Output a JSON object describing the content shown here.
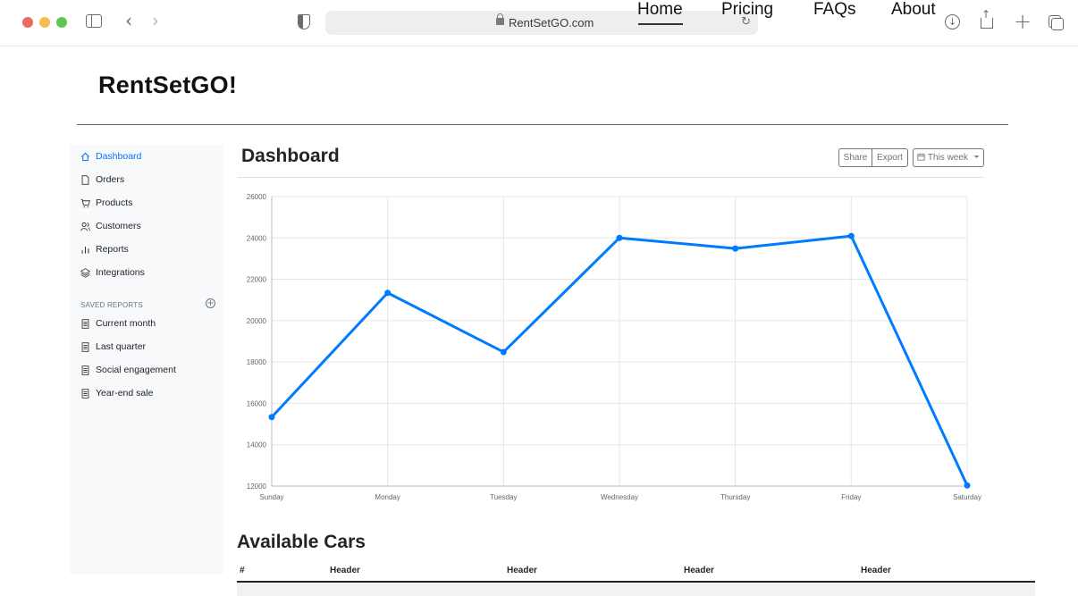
{
  "browser": {
    "url": "RentSetGO.com"
  },
  "site": {
    "brand": "RentSetGO!",
    "nav": [
      "Home",
      "Pricing",
      "FAQs",
      "About"
    ]
  },
  "sidebar": {
    "items": [
      {
        "label": "Dashboard",
        "icon": "home-icon"
      },
      {
        "label": "Orders",
        "icon": "file-icon"
      },
      {
        "label": "Products",
        "icon": "cart-icon"
      },
      {
        "label": "Customers",
        "icon": "users-icon"
      },
      {
        "label": "Reports",
        "icon": "bar-chart-icon"
      },
      {
        "label": "Integrations",
        "icon": "layers-icon"
      }
    ],
    "saved_heading": "SAVED REPORTS",
    "saved": [
      {
        "label": "Current month",
        "icon": "file-text-icon"
      },
      {
        "label": "Last quarter",
        "icon": "file-text-icon"
      },
      {
        "label": "Social engagement",
        "icon": "file-text-icon"
      },
      {
        "label": "Year-end sale",
        "icon": "file-text-icon"
      }
    ]
  },
  "main": {
    "title": "Dashboard",
    "toolbar": {
      "share": "Share",
      "export": "Export",
      "range": "This week"
    },
    "section_title": "Available Cars",
    "table_headers": [
      "#",
      "Header",
      "Header",
      "Header",
      "Header"
    ]
  },
  "colors": {
    "accent": "#007bff",
    "active_link": "#0d6efd"
  },
  "chart_data": {
    "type": "line",
    "categories": [
      "Sunday",
      "Monday",
      "Tuesday",
      "Wednesday",
      "Thursday",
      "Friday",
      "Saturday"
    ],
    "values": [
      15339,
      21345,
      18483,
      24003,
      23489,
      24092,
      12034
    ],
    "ylim": [
      12000,
      26000
    ],
    "yticks": [
      12000,
      14000,
      16000,
      18000,
      20000,
      22000,
      24000,
      26000
    ],
    "grid": true,
    "legend": "none",
    "color": "#007bff"
  }
}
